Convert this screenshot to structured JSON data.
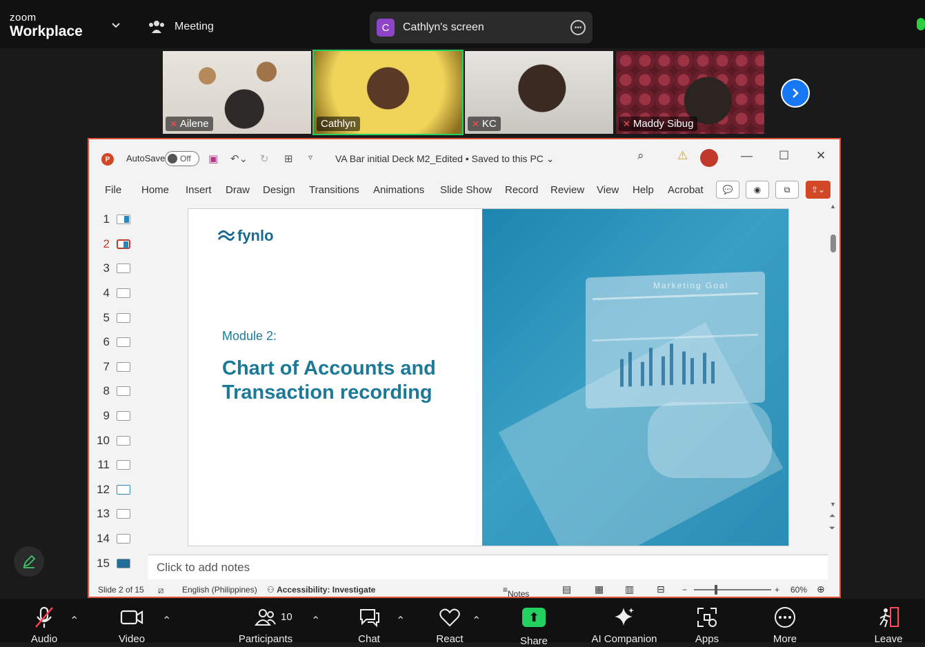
{
  "zoom": {
    "brand_top": "zoom",
    "brand_bottom": "Workplace",
    "meeting_label": "Meeting",
    "screen_share": {
      "avatar_letter": "C",
      "label": "Cathlyn's screen"
    },
    "participants": [
      {
        "name": "Ailene",
        "muted": true
      },
      {
        "name": "Cathlyn",
        "muted": false,
        "active": true
      },
      {
        "name": "KC",
        "muted": true
      },
      {
        "name": "Maddy Sibug",
        "muted": true
      }
    ],
    "toolbar": {
      "audio": "Audio",
      "video": "Video",
      "participants": "Participants",
      "participants_count": "10",
      "chat": "Chat",
      "react": "React",
      "share": "Share",
      "ai": "AI Companion",
      "apps": "Apps",
      "more": "More",
      "leave": "Leave"
    }
  },
  "ppt": {
    "autosave_label": "AutoSave",
    "autosave_state": "Off",
    "doc_title": "VA Bar initial Deck M2_Edited • Saved to this PC",
    "tabs": [
      "File",
      "Home",
      "Insert",
      "Draw",
      "Design",
      "Transitions",
      "Animations",
      "Slide Show",
      "Record",
      "Review",
      "View",
      "Help",
      "Acrobat"
    ],
    "slide_count": 15,
    "selected_slide": 2,
    "slide": {
      "logo_text": "fynlo",
      "module": "Module 2:",
      "title": "Chart of Accounts and Transaction recording",
      "screen_title": "Marketing Goal"
    },
    "notes_placeholder": "Click to add notes",
    "status": {
      "slide_indicator": "Slide 2 of 15",
      "language": "English (Philippines)",
      "accessibility": "Accessibility: Investigate",
      "notes": "Notes",
      "zoom": "60%"
    }
  },
  "colors": {
    "accent_green": "#23d160",
    "ppt_red": "#d24726",
    "slide_teal": "#1c7a98"
  }
}
